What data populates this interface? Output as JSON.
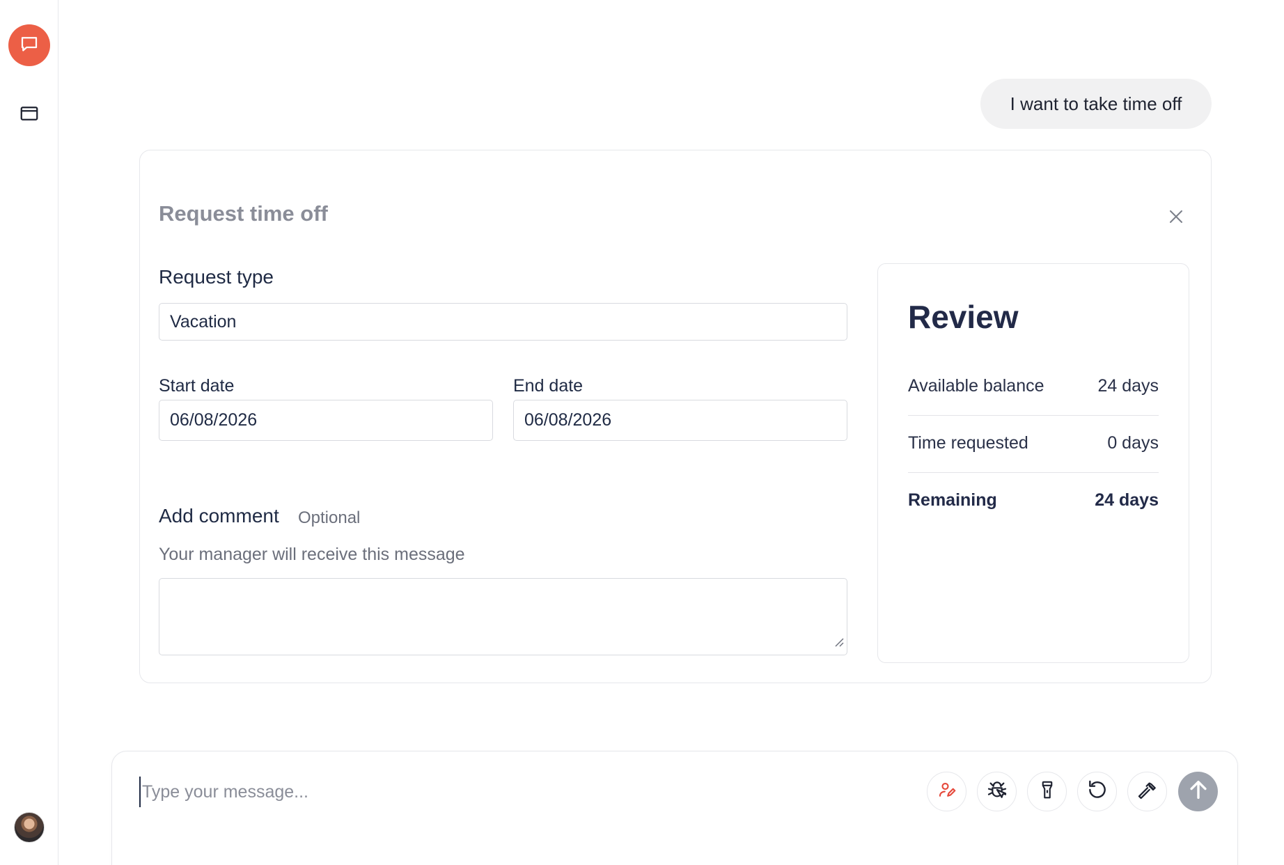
{
  "sidebar": {
    "items": [
      {
        "icon": "chat-bubble-icon",
        "active": true
      },
      {
        "icon": "browser-window-icon",
        "active": false
      }
    ],
    "accent_color": "#ec5f46"
  },
  "conversation": {
    "user_message": "I want to take time off"
  },
  "form": {
    "title": "Request time off",
    "request_type_label": "Request type",
    "request_type_value": "Vacation",
    "start_date_label": "Start date",
    "start_date_value": "06/08/2026",
    "end_date_label": "End date",
    "end_date_value": "06/08/2026",
    "comment_label": "Add comment",
    "comment_optional": "Optional",
    "comment_helper": "Your manager will receive this message",
    "comment_value": ""
  },
  "review": {
    "title": "Review",
    "rows": [
      {
        "label": "Available balance",
        "value": "24 days"
      },
      {
        "label": "Time requested",
        "value": "0 days"
      },
      {
        "label": "Remaining",
        "value": "24 days"
      }
    ]
  },
  "composer": {
    "placeholder": "Type your message...",
    "tools": [
      "user-edit-icon",
      "bug-icon",
      "flashlight-icon",
      "undo-icon",
      "hammer-icon"
    ],
    "send_icon": "arrow-up-icon"
  }
}
